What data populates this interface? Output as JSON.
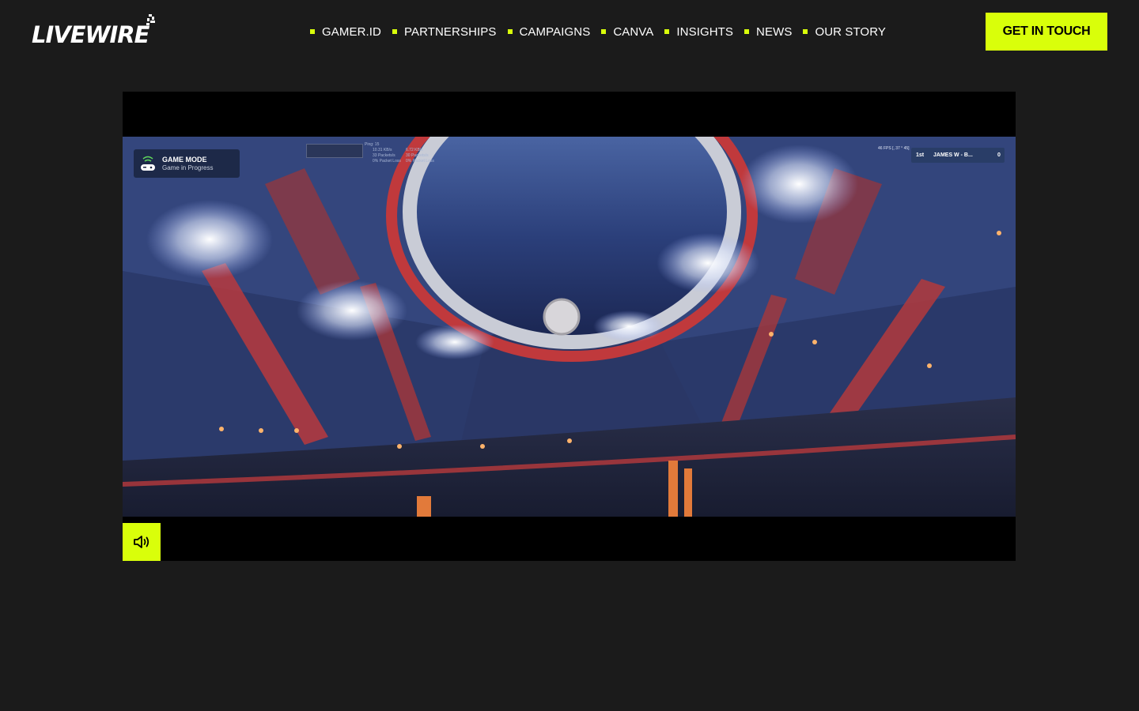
{
  "brand": {
    "logo_text": "LIVEWIRE"
  },
  "nav": {
    "items": [
      {
        "label": "GAMER.ID"
      },
      {
        "label": "PARTNERSHIPS"
      },
      {
        "label": "CAMPAIGNS"
      },
      {
        "label": "CANVA"
      },
      {
        "label": "INSIGHTS"
      },
      {
        "label": "NEWS"
      },
      {
        "label": "OUR STORY"
      }
    ]
  },
  "cta": {
    "label": "GET IN TOUCH"
  },
  "video": {
    "hud": {
      "mode_title": "GAME MODE",
      "mode_status": "Game in Progress",
      "ping": "Ping: 15",
      "up_rate": "10.31 KB/s",
      "up_packets": "33 Packets/s",
      "up_loss": "0% Packet Loss",
      "down_rate": "6.72 KB/s",
      "down_packets": "30 Packets/s",
      "down_loss": "0% Packet Loss",
      "fps": "46 FPS [, 37 ° 45]",
      "place": "1st",
      "player": "JAMES W - B...",
      "points": "0"
    },
    "controls": {
      "mute_icon": "speaker-volume-icon"
    }
  },
  "colors": {
    "accent": "#d9ff0a",
    "background": "#1b1b1b",
    "video_bg": "#000000"
  }
}
